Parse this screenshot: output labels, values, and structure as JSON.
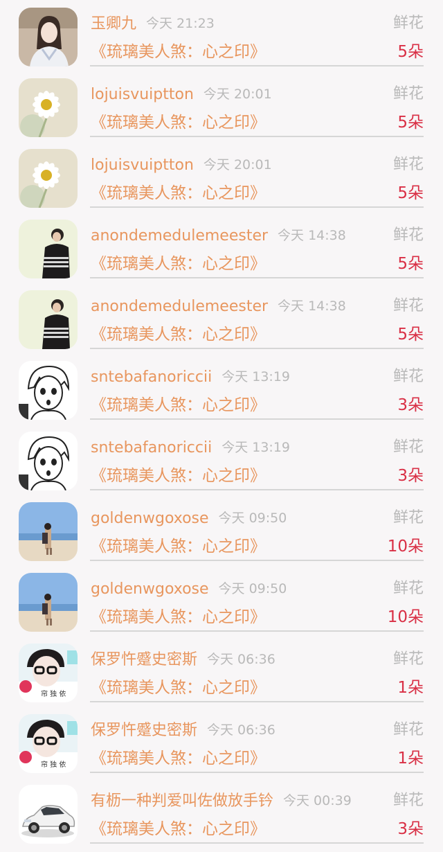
{
  "rows": [
    {
      "name": "玉卿九",
      "time": "今天 21:23",
      "gift": "鲜花",
      "book": "《琉璃美人煞：心之印》",
      "count": "5朵",
      "avatar": "girl-portrait"
    },
    {
      "name": "lojuisvuiptton",
      "time": "今天 20:01",
      "gift": "鲜花",
      "book": "《琉璃美人煞：心之印》",
      "count": "5朵",
      "avatar": "daisy"
    },
    {
      "name": "lojuisvuiptton",
      "time": "今天 20:01",
      "gift": "鲜花",
      "book": "《琉璃美人煞：心之印》",
      "count": "5朵",
      "avatar": "daisy"
    },
    {
      "name": "anondemedulemeester",
      "time": "今天 14:38",
      "gift": "鲜花",
      "book": "《琉璃美人煞：心之印》",
      "count": "5朵",
      "avatar": "boy-jacket"
    },
    {
      "name": "anondemedulemeester",
      "time": "今天 14:38",
      "gift": "鲜花",
      "book": "《琉璃美人煞：心之印》",
      "count": "5朵",
      "avatar": "boy-jacket"
    },
    {
      "name": "sntebafanoriccii",
      "time": "今天 13:19",
      "gift": "鲜花",
      "book": "《琉璃美人煞：心之印》",
      "count": "3朵",
      "avatar": "manga-boy"
    },
    {
      "name": "sntebafanoriccii",
      "time": "今天 13:19",
      "gift": "鲜花",
      "book": "《琉璃美人煞：心之印》",
      "count": "3朵",
      "avatar": "manga-boy"
    },
    {
      "name": "goldenwgoxose",
      "time": "今天 09:50",
      "gift": "鲜花",
      "book": "《琉璃美人煞：心之印》",
      "count": "10朵",
      "avatar": "beach-couple"
    },
    {
      "name": "goldenwgoxose",
      "time": "今天 09:50",
      "gift": "鲜花",
      "book": "《琉璃美人煞：心之印》",
      "count": "10朵",
      "avatar": "beach-couple"
    },
    {
      "name": "保罗忤蹙史密斯",
      "time": "今天 06:36",
      "gift": "鲜花",
      "book": "《琉璃美人煞：心之印》",
      "count": "1朵",
      "avatar": "glasses-boy"
    },
    {
      "name": "保罗忤蹙史密斯",
      "time": "今天 06:36",
      "gift": "鲜花",
      "book": "《琉璃美人煞：心之印》",
      "count": "1朵",
      "avatar": "glasses-boy"
    },
    {
      "name": "有枥一种判爱叫佐做放手钤",
      "time": "今天 00:39",
      "gift": "鲜花",
      "book": "《琉璃美人煞：心之印》",
      "count": "3朵",
      "avatar": "white-car"
    }
  ]
}
